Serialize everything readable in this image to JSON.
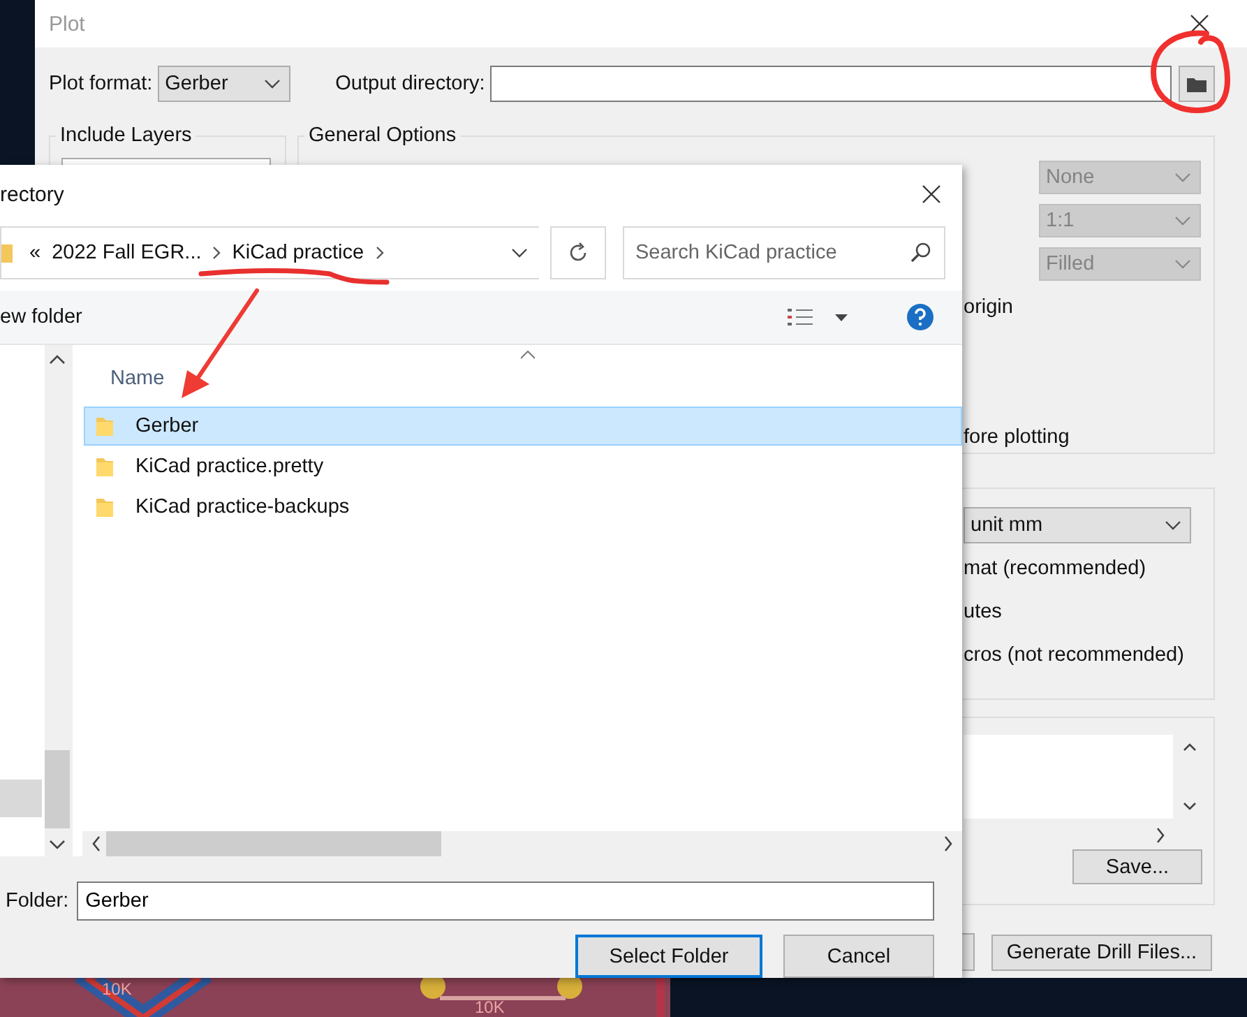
{
  "board": {
    "labels": [
      "10K",
      "10K"
    ]
  },
  "plot_dialog": {
    "title": "Plot",
    "format_label": "Plot format:",
    "format": {
      "value": "Gerber",
      "disabled": false
    },
    "output_label": "Output directory:",
    "include_layers": {
      "title": "Include Layers"
    },
    "general_options": {
      "title": "General Options",
      "rows": [
        {
          "kind": "select",
          "value": "None",
          "disabled": true
        },
        {
          "kind": "select",
          "value": "1:1",
          "disabled": true
        },
        {
          "kind": "select",
          "value": "Filled",
          "disabled": true
        },
        {
          "kind": "text",
          "text": "origin"
        },
        {
          "kind": "blank"
        },
        {
          "kind": "blank"
        },
        {
          "kind": "text",
          "text": "fore plotting"
        }
      ]
    },
    "gerber_options": {
      "rows": [
        {
          "kind": "select",
          "value": "unit mm",
          "disabled": false
        },
        {
          "kind": "text",
          "text": "mat (recommended)"
        },
        {
          "kind": "text",
          "text": "utes"
        },
        {
          "kind": "text",
          "text": "cros (not recommended)"
        }
      ]
    },
    "save_button": "Save...",
    "drill_button": "Generate Drill Files..."
  },
  "folder_dialog": {
    "title": "rectory",
    "overflow": "«",
    "crumbs": [
      "2022 Fall EGR...",
      "KiCad practice"
    ],
    "search": {
      "placeholder": "Search KiCad practice"
    },
    "new_folder": "ew folder",
    "column": "Name",
    "rows": [
      {
        "name": "Gerber",
        "selected": true
      },
      {
        "name": "KiCad practice.pretty",
        "selected": false
      },
      {
        "name": "KiCad practice-backups",
        "selected": false
      }
    ],
    "folder_label": "Folder:",
    "folder_value": "Gerber",
    "buttons": [
      {
        "label": "Select Folder",
        "default": true
      },
      {
        "label": "Cancel",
        "default": false
      }
    ]
  }
}
